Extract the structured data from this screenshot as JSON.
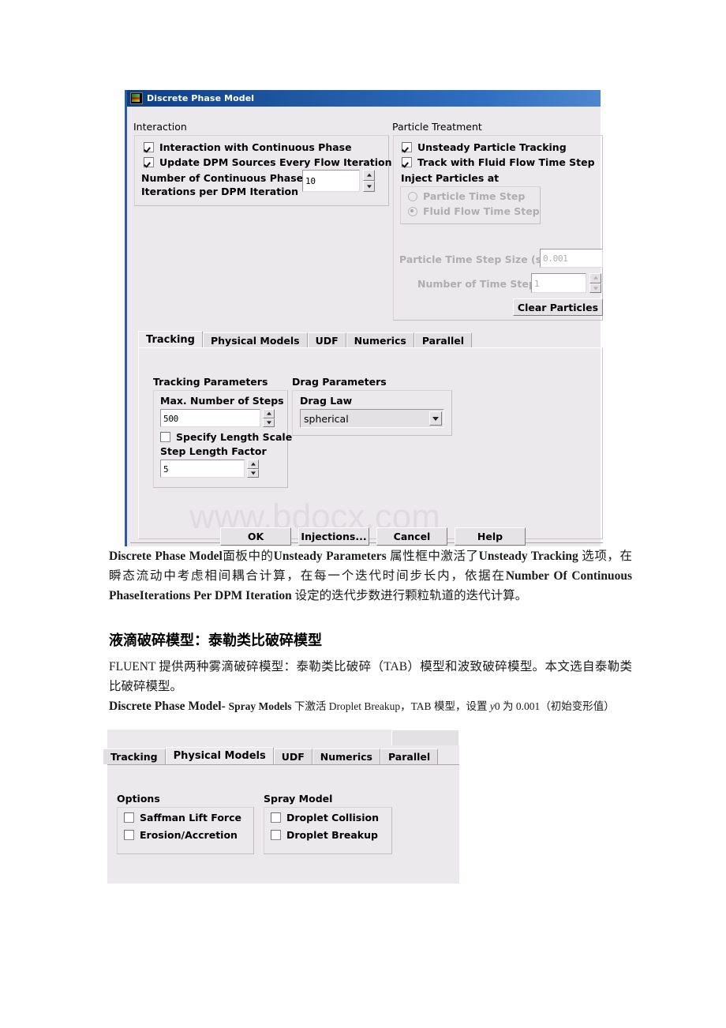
{
  "dialog": {
    "title": "Discrete Phase Model",
    "title_icon": "contour-icon",
    "interaction": {
      "group_label": "Interaction",
      "checkboxes": [
        {
          "label": "Interaction with Continuous Phase",
          "checked": true
        },
        {
          "label": "Update DPM Sources Every Flow Iteration",
          "checked": true
        }
      ],
      "iterations_label_line1": "Number of Continuous Phase",
      "iterations_label_line2": "Iterations per DPM Iteration",
      "iterations_value": "10"
    },
    "particle_treatment": {
      "group_label": "Particle Treatment",
      "checkboxes": [
        {
          "label": "Unsteady Particle Tracking",
          "checked": true
        },
        {
          "label": "Track with Fluid Flow Time Step",
          "checked": true
        }
      ],
      "inject_label": "Inject Particles at",
      "inject_options": [
        {
          "label": "Particle Time Step",
          "selected": false
        },
        {
          "label": "Fluid Flow Time Step",
          "selected": true
        }
      ],
      "time_step_size_label": "Particle Time Step Size (s)",
      "time_step_size_value": "0.001",
      "number_of_time_steps_label": "Number of Time Steps",
      "number_of_time_steps_value": "1",
      "clear_particles_button": "Clear Particles"
    },
    "tabs": [
      {
        "label": "Tracking",
        "active": true
      },
      {
        "label": "Physical Models",
        "active": false
      },
      {
        "label": "UDF",
        "active": false
      },
      {
        "label": "Numerics",
        "active": false
      },
      {
        "label": "Parallel",
        "active": false
      }
    ],
    "tracking_tab": {
      "tracking_parameters_label": "Tracking Parameters",
      "max_steps_label": "Max. Number of Steps",
      "max_steps_value": "500",
      "specify_length_scale": {
        "label": "Specify Length Scale",
        "checked": false
      },
      "step_length_factor_label": "Step Length Factor",
      "step_length_factor_value": "5",
      "drag_parameters_label": "Drag Parameters",
      "drag_law_label": "Drag Law",
      "drag_law_value": "spherical"
    },
    "buttons": [
      {
        "label": "OK"
      },
      {
        "label": "Injections..."
      },
      {
        "label": "Cancel"
      },
      {
        "label": "Help"
      }
    ],
    "watermark": "www.bdocx.com"
  },
  "document": {
    "paragraph1": {
      "seg1": "Discrete Phase Model",
      "seg2": "面板中的",
      "seg3": "Unsteady Parameters",
      "seg4": " 属性框中激活了",
      "seg5": "Unsteady Tracking",
      "seg6": " 选项，在瞬态流动中考虑相间耦合计算，在每一个迭代时间步长内，依据在",
      "seg7": "Number Of Continuous PhaseIterations Per DPM Iteration",
      "seg8": " 设定的迭代步数进行颗粒轨道的迭代计算。"
    },
    "heading": "液滴破碎模型：泰勒类比破碎模型",
    "paragraph2": "FLUENT 提供两种雾滴破碎模型：泰勒类比破碎（TAB）模型和波致破碎模型。本文选自泰勒类比破碎模型。",
    "paragraph3": {
      "seg1": "Discrete Phase Model- ",
      "seg2": "Spray Models",
      "seg3": " 下激活 Droplet Breakup，TAB 模型，设置 ",
      "seg4": "y",
      "seg5": "0 为 0.001（初始变形值）"
    }
  },
  "physical_models_panel": {
    "tabs": [
      {
        "label": "Tracking",
        "active": false
      },
      {
        "label": "Physical Models",
        "active": true
      },
      {
        "label": "UDF",
        "active": false
      },
      {
        "label": "Numerics",
        "active": false
      },
      {
        "label": "Parallel",
        "active": false
      }
    ],
    "options_label": "Options",
    "options": [
      {
        "label": "Saffman Lift Force",
        "checked": false
      },
      {
        "label": "Erosion/Accretion",
        "checked": false
      }
    ],
    "spray_model_label": "Spray Model",
    "spray_models": [
      {
        "label": "Droplet Collision",
        "checked": false
      },
      {
        "label": "Droplet Breakup",
        "checked": false
      }
    ]
  },
  "colors": {
    "title_bar_start": "#0d3f86",
    "title_bar_end": "#4d86cf",
    "dialog_bg": "#ece9ec",
    "disabled_text": "#b0adb0",
    "watermark": "#e0dbe0"
  }
}
